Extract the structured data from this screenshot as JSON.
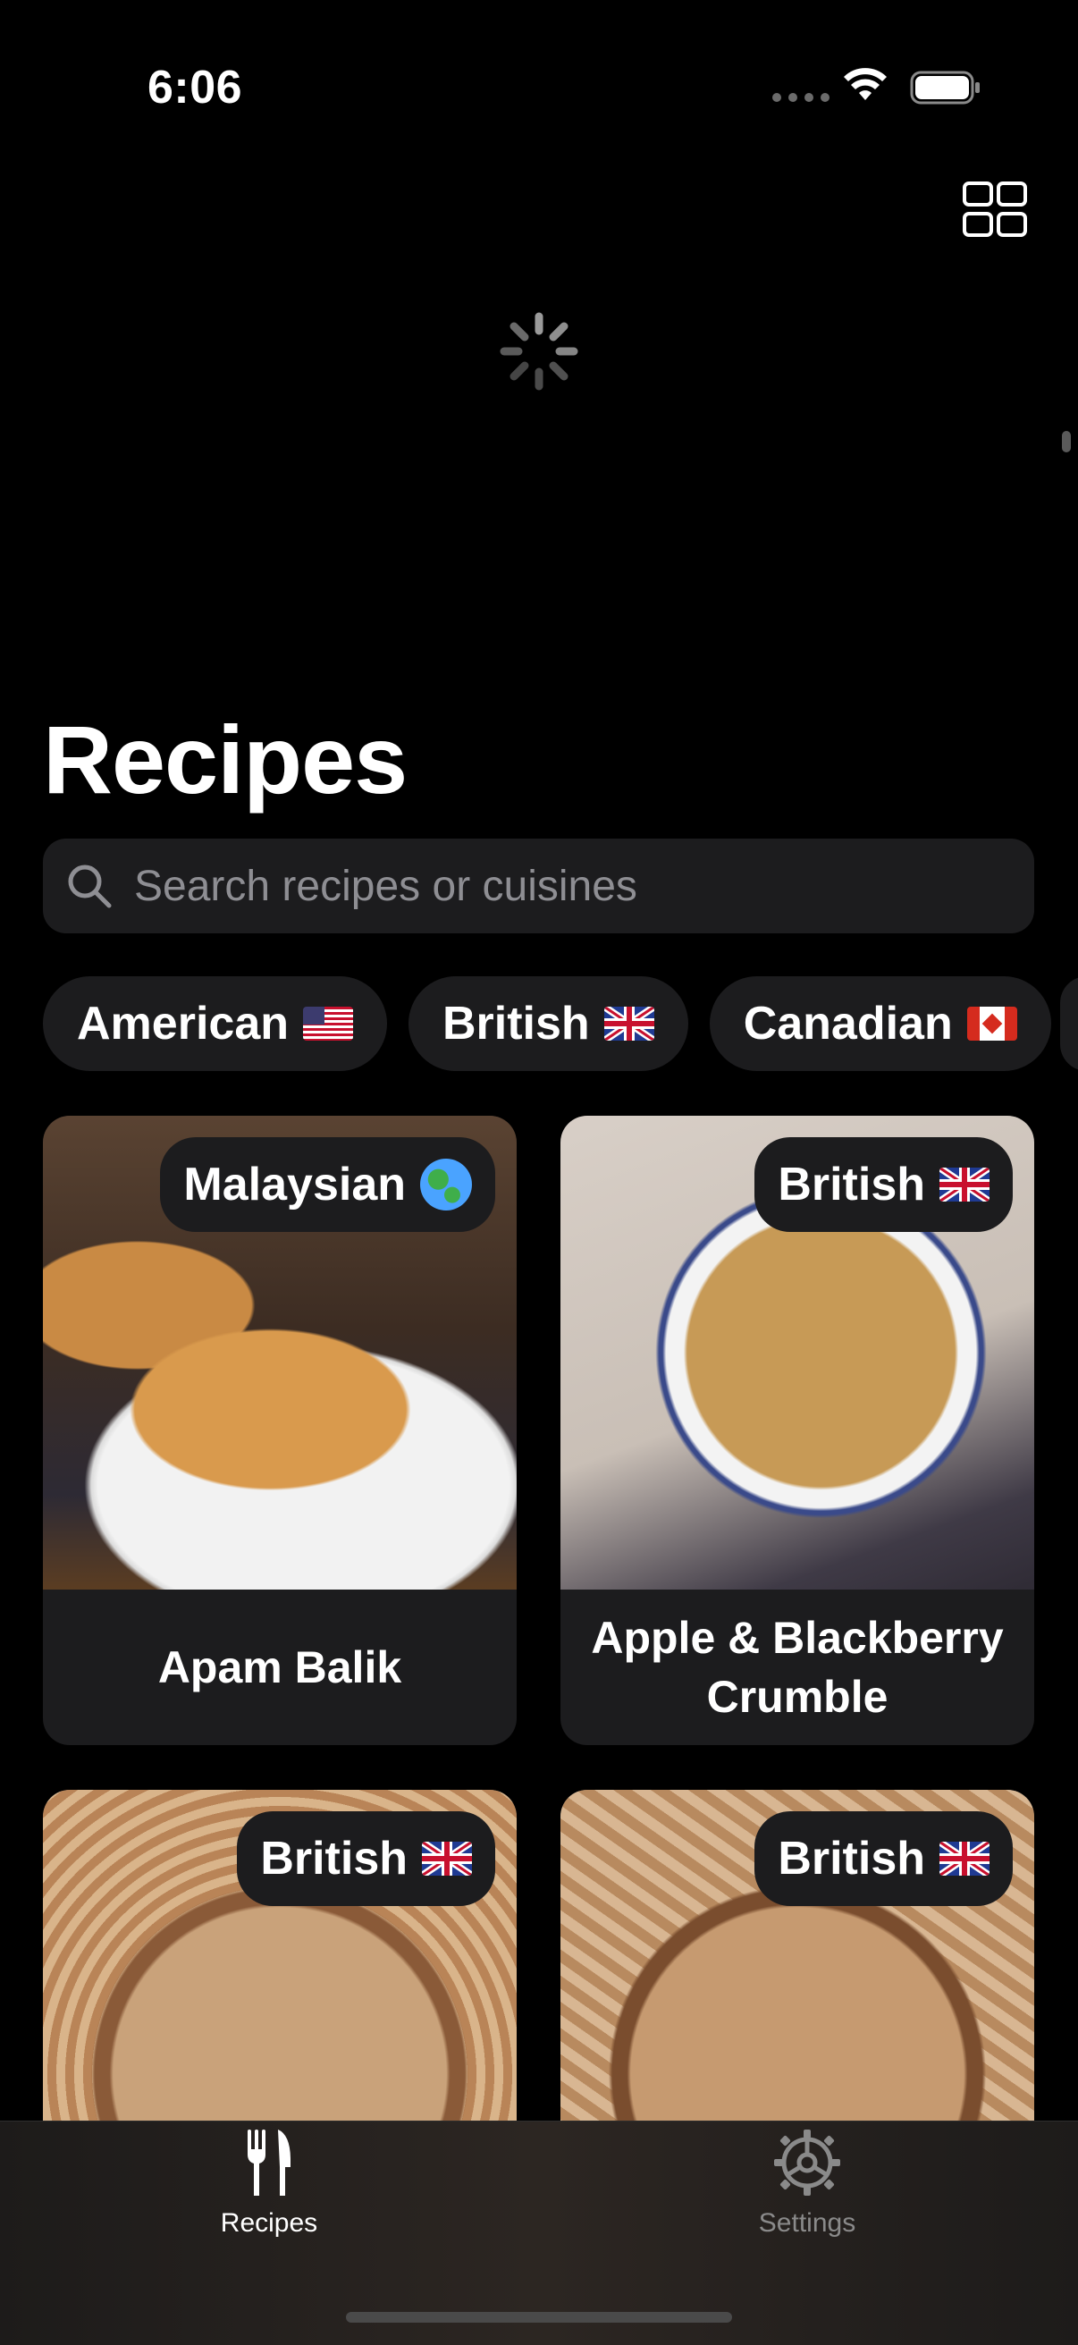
{
  "status_bar": {
    "time": "6:06"
  },
  "page": {
    "title": "Recipes"
  },
  "search": {
    "placeholder": "Search recipes or cuisines"
  },
  "filters": [
    {
      "label": "American",
      "flag": "us-flag"
    },
    {
      "label": "British",
      "flag": "uk-flag"
    },
    {
      "label": "Canadian",
      "flag": "ca-flag"
    }
  ],
  "recipes": [
    {
      "name": "Apam Balik",
      "cuisine": "Malaysian",
      "cuisine_icon": "globe-icon"
    },
    {
      "name": "Apple & Blackberry Crumble",
      "cuisine": "British",
      "cuisine_icon": "uk-flag"
    },
    {
      "name": "",
      "cuisine": "British",
      "cuisine_icon": "uk-flag"
    },
    {
      "name": "",
      "cuisine": "British",
      "cuisine_icon": "uk-flag"
    }
  ],
  "tabs": [
    {
      "label": "Recipes",
      "icon": "fork-knife-icon",
      "selected": true
    },
    {
      "label": "Settings",
      "icon": "gear-icon",
      "selected": false
    }
  ],
  "colors": {
    "background": "#000000",
    "surface": "#1c1c1e",
    "placeholder": "#8e8e93",
    "inactive_tab": "#8a8a8a"
  }
}
